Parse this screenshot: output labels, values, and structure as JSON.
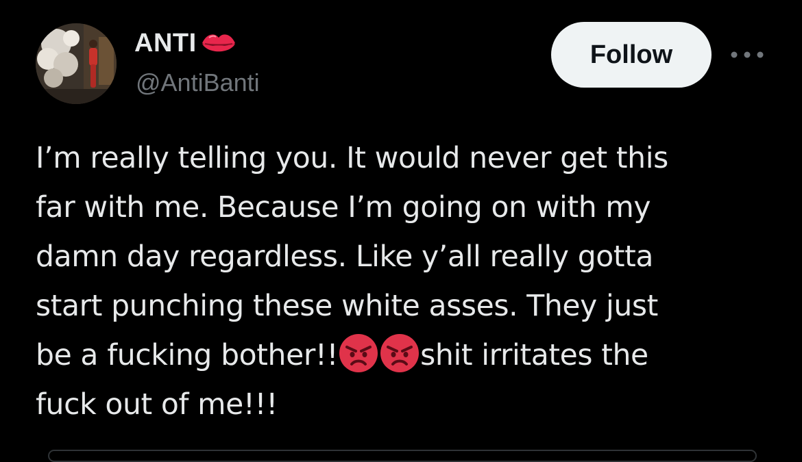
{
  "author": {
    "display_name": "ANTI",
    "name_emoji": "kiss-mark-icon",
    "handle": "@AntiBanti"
  },
  "actions": {
    "follow_label": "Follow",
    "more_icon": "more-horizontal-icon"
  },
  "tweet": {
    "lines": [
      "I’m really telling you. It would never get this",
      "far with me. Because I’m going on with my",
      "damn day regardless. Like y’all really gotta",
      "start punching these white asses. They just"
    ],
    "line5_before": "be a fucking bother!!",
    "line5_emojis": [
      "angry-face-icon",
      "angry-face-icon"
    ],
    "line5_after": "shit irritates the",
    "line6": "fuck out of me!!!"
  },
  "colors": {
    "background": "#000000",
    "text": "#e7e9ea",
    "secondary_text": "#71767b",
    "follow_bg": "#eff3f4",
    "angry_emoji": "#e0334a",
    "kiss_emoji": "#e8264c"
  }
}
